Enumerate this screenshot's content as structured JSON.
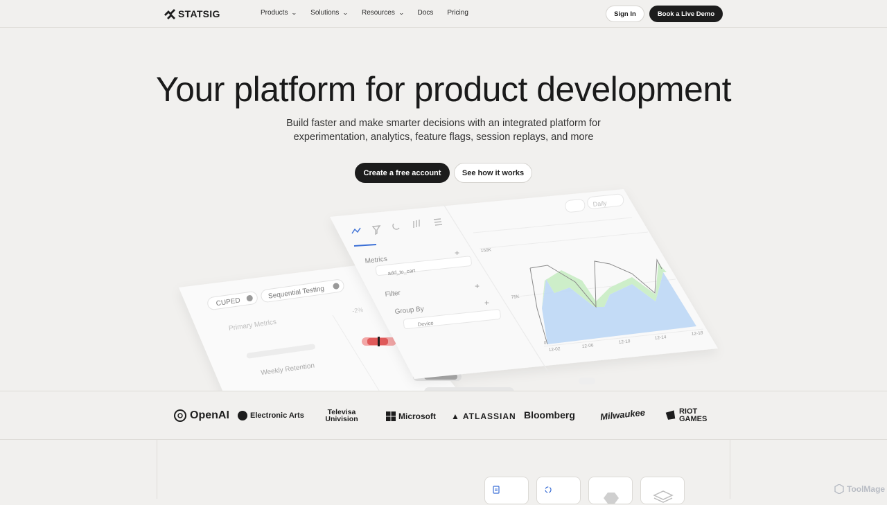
{
  "brand": {
    "name": "STATSIG"
  },
  "nav": {
    "items": [
      {
        "label": "Products",
        "has_menu": true
      },
      {
        "label": "Solutions",
        "has_menu": true
      },
      {
        "label": "Resources",
        "has_menu": true
      },
      {
        "label": "Docs",
        "has_menu": false
      },
      {
        "label": "Pricing",
        "has_menu": false
      }
    ],
    "sign_in": "Sign In",
    "demo": "Book a Live Demo"
  },
  "hero": {
    "title": "Your platform for product development",
    "subtitle": "Build faster and make smarter decisions with an integrated platform for experimentation, analytics, feature flags, session replays, and more",
    "cta_primary": "Create a free account",
    "cta_secondary": "See how it works"
  },
  "illustration": {
    "left_card": {
      "tags": [
        "CUPED",
        "Sequential Testing"
      ],
      "primary_metrics": "Primary Metrics",
      "delta": "-2%",
      "weekly_retention": "Weekly Retention"
    },
    "right_card": {
      "metrics_label": "Metrics",
      "metric_chip": "add_to_cart",
      "filter_label": "Filter",
      "group_by_label": "Group By",
      "group_chip": "Device",
      "interval": "Daily",
      "y_ticks": [
        "150K",
        "75K",
        "0"
      ],
      "x_ticks": [
        "12-02",
        "12-06",
        "12-10",
        "12-14",
        "12-18"
      ]
    }
  },
  "customers": {
    "logos": [
      "OpenAI",
      "Electronic Arts",
      "Televisa Univision",
      "Microsoft",
      "ATLASSIAN",
      "Bloomberg",
      "Milwaukee",
      "RIOT GAMES"
    ]
  },
  "watermark": "ToolMage",
  "colors": {
    "dark": "#1c1c1c",
    "bg": "#f1f0ee",
    "chart_blue": "#bcd7f5",
    "chart_green": "#cdeec9",
    "accent_red": "#e05a5a"
  }
}
